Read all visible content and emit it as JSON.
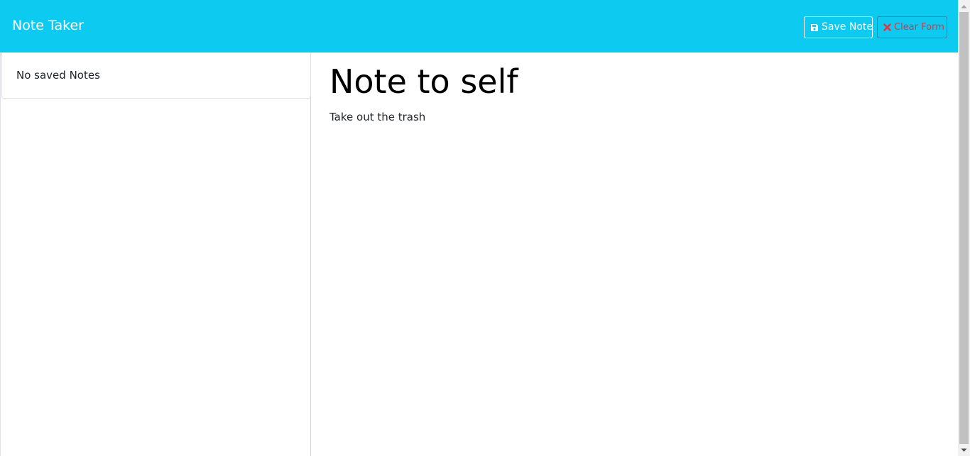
{
  "navbar": {
    "brand": "Note Taker",
    "save_label": "Save Note",
    "clear_label": "Clear Form",
    "save_icon": "floppy-disk-icon",
    "clear_icon": "x-mark-icon",
    "colors": {
      "background": "#0dcaf0",
      "save": "#ffffff",
      "clear": "#dc3545"
    }
  },
  "sidebar": {
    "empty_message": "No saved Notes"
  },
  "note": {
    "title": "Note to self",
    "text": "Take out the trash"
  }
}
